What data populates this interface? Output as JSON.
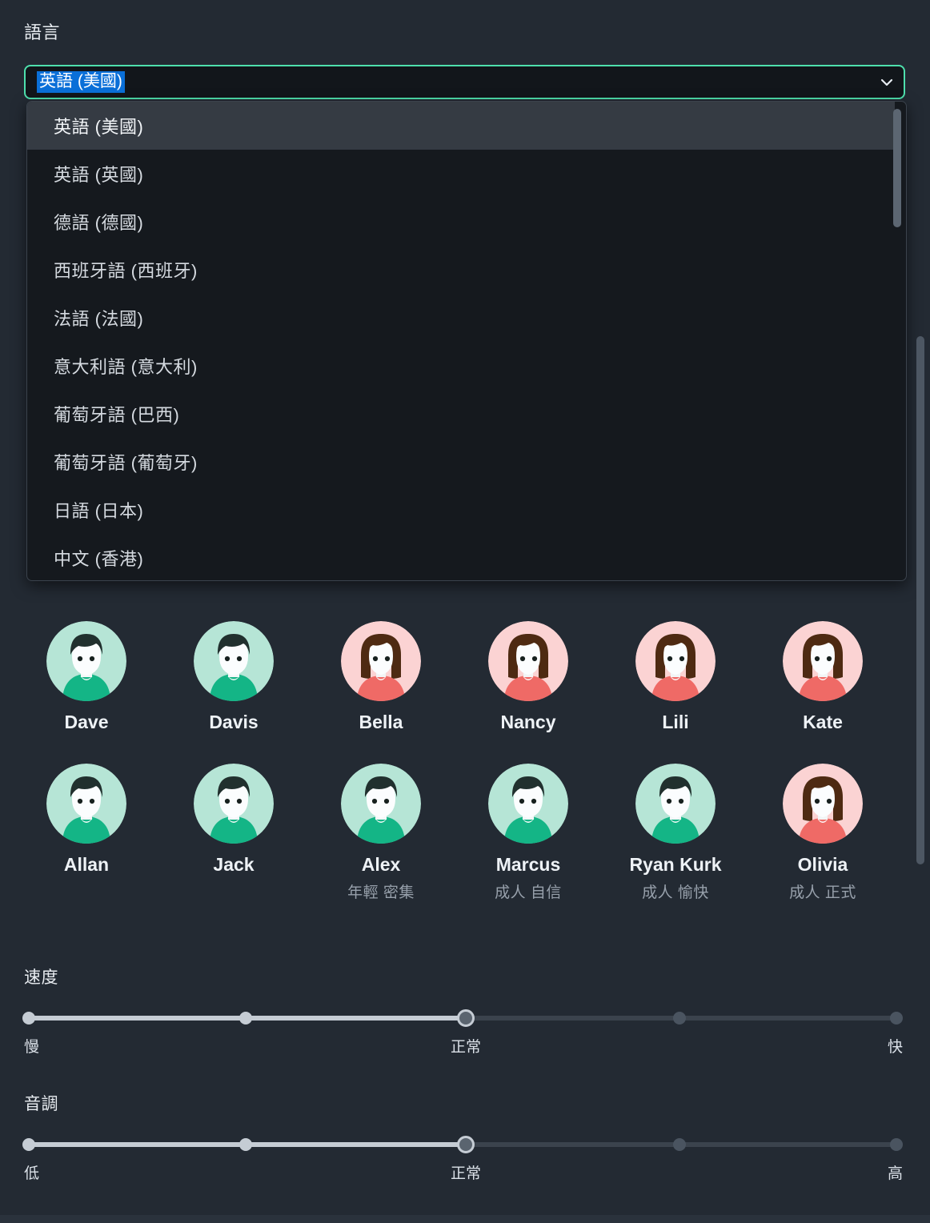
{
  "language": {
    "label": "語言",
    "selected": "英語 (美國)",
    "dropdown_open": true,
    "options": [
      "英語 (美國)",
      "英語 (英國)",
      "德語 (德國)",
      "西班牙語 (西班牙)",
      "法語 (法國)",
      "意大利語 (意大利)",
      "葡萄牙語 (巴西)",
      "葡萄牙語 (葡萄牙)",
      "日語 (日本)",
      "中文 (香港)"
    ],
    "selected_index": 0,
    "arrow_icon": "chevron-down-icon"
  },
  "voices": {
    "row1": [
      {
        "name": "Dave",
        "sub": "",
        "gender": "male"
      },
      {
        "name": "Davis",
        "sub": "",
        "gender": "male"
      },
      {
        "name": "Bella",
        "sub": "",
        "gender": "female"
      },
      {
        "name": "Nancy",
        "sub": "",
        "gender": "female"
      },
      {
        "name": "Lili",
        "sub": "",
        "gender": "female"
      },
      {
        "name": "Kate",
        "sub": "",
        "gender": "female"
      }
    ],
    "row2": [
      {
        "name": "Allan",
        "sub": "",
        "gender": "male"
      },
      {
        "name": "Jack",
        "sub": "",
        "gender": "male"
      },
      {
        "name": "Alex",
        "sub": "年輕 密集",
        "gender": "male"
      },
      {
        "name": "Marcus",
        "sub": "成人 自信",
        "gender": "male"
      },
      {
        "name": "Ryan Kurk",
        "sub": "成人 愉快",
        "gender": "male"
      },
      {
        "name": "Olivia",
        "sub": "成人 正式",
        "gender": "female"
      }
    ]
  },
  "speed": {
    "title": "速度",
    "left_label": "慢",
    "mid_label": "正常",
    "right_label": "快",
    "value": 3,
    "steps": 5
  },
  "pitch": {
    "title": "音調",
    "left_label": "低",
    "mid_label": "正常",
    "right_label": "高",
    "value": 3,
    "steps": 5
  },
  "colors": {
    "background": "#232a33",
    "accent": "#4ee0ad",
    "selection_blue": "#0a6fd8",
    "male_bg": "#b6e5d6",
    "male_shirt": "#14b586",
    "male_hair": "#21302e",
    "female_bg": "#fbd3d3",
    "female_shirt": "#ef6a66",
    "female_hair": "#4e2a12"
  }
}
